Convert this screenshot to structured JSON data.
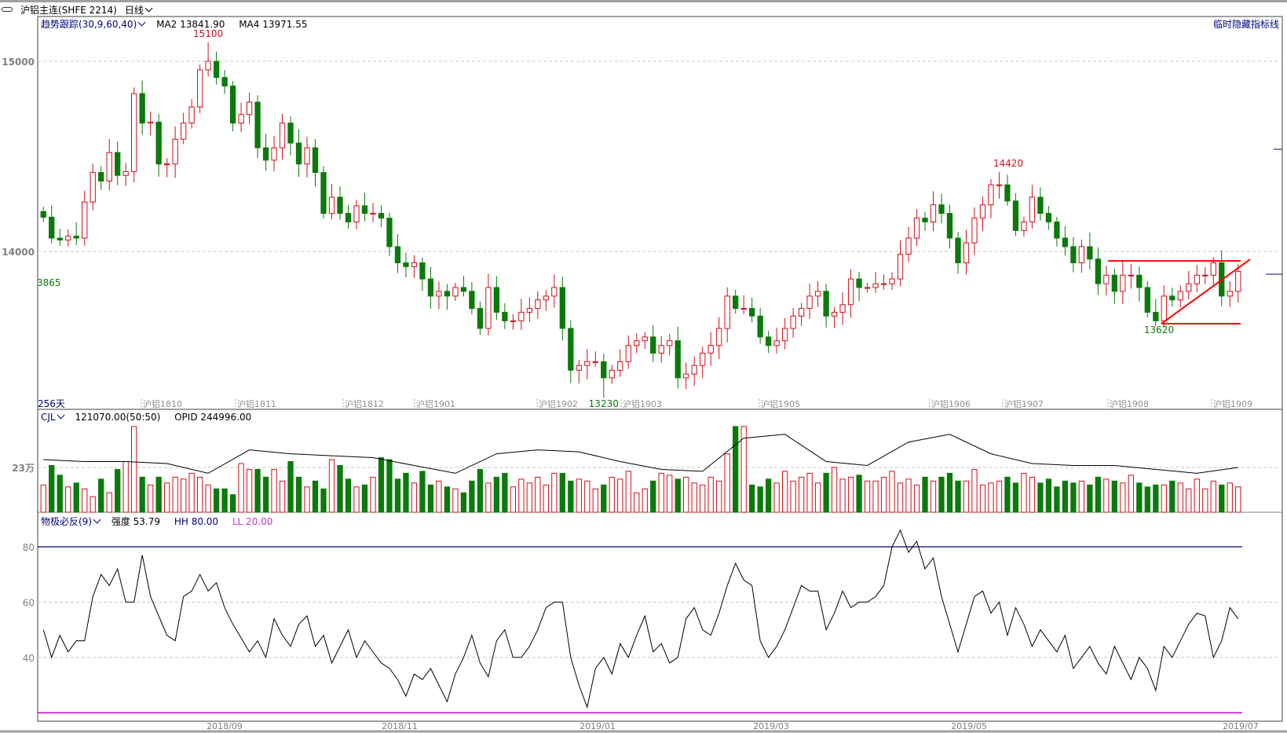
{
  "window": {
    "symbol_title": "沪铝主连(SHFE 2214)",
    "period": "日线",
    "hide_indicator_link": "临时隐藏指标线",
    "link_icon": "link-icon"
  },
  "price_panel": {
    "indicator": "趋势跟踪(30,9,60,40)",
    "ma2": "MA2 13841.90",
    "ma4": "MA4 13971.55",
    "day_count": "256天",
    "y_ticks": [
      "15000",
      "14000"
    ],
    "annotations": {
      "high": "15100",
      "low": "13230",
      "left_low": "3865",
      "peak": "14420",
      "recent_low": "13620"
    },
    "contract_labels": [
      "沪铝1810",
      "沪铝1811",
      "沪铝1812",
      "沪铝1901",
      "沪铝1902",
      "沪铝1903",
      "沪铝1905",
      "沪铝1906",
      "沪铝1907",
      "沪铝1908",
      "沪铝1909"
    ]
  },
  "volume_panel": {
    "name": "CJL",
    "value": "121070.00(50:50)",
    "opid": "OPID 244996.00",
    "y_tick": "23万"
  },
  "osc_panel": {
    "name": "物极必反(9)",
    "strength": "强度 53.79",
    "hh": "HH 80.00",
    "ll": "LL 20.00",
    "y_ticks": [
      "80",
      "60",
      "40"
    ]
  },
  "x_axis": {
    "dates": [
      "2018/09",
      "2018/11",
      "2019/01",
      "2019/03",
      "2019/05",
      "2019/07"
    ]
  },
  "colors": {
    "up": "#d0101a",
    "down": "#0a7a0a",
    "navy": "#000080",
    "ll": "#cc33cc",
    "trendline": "#ff0000"
  },
  "chart_data": [
    {
      "type": "candlestick",
      "title": "沪铝主连(SHFE 2214) 日线",
      "ylim": [
        13200,
        15150
      ],
      "yticks": [
        14000,
        15000
      ],
      "grid": true,
      "closes": [
        14180,
        14070,
        14060,
        14080,
        14070,
        14260,
        14415,
        14370,
        14520,
        14400,
        14420,
        14830,
        14675,
        14680,
        14460,
        14460,
        14590,
        14675,
        14760,
        14955,
        15000,
        14915,
        14870,
        14675,
        14720,
        14785,
        14545,
        14480,
        14545,
        14675,
        14570,
        14460,
        14545,
        14415,
        14200,
        14285,
        14200,
        14155,
        14240,
        14200,
        14200,
        14175,
        14025,
        13940,
        13920,
        13940,
        13855,
        13765,
        13790,
        13765,
        13810,
        13790,
        13700,
        13595,
        13810,
        13680,
        13635,
        13635,
        13680,
        13700,
        13745,
        13765,
        13810,
        13595,
        13375,
        13400,
        13420,
        13420,
        13335,
        13375,
        13420,
        13505,
        13530,
        13550,
        13465,
        13505,
        13530,
        13335,
        13355,
        13400,
        13465,
        13505,
        13595,
        13765,
        13700,
        13700,
        13660,
        13550,
        13505,
        13530,
        13595,
        13660,
        13700,
        13765,
        13790,
        13660,
        13680,
        13720,
        13855,
        13810,
        13810,
        13830,
        13830,
        13855,
        13985,
        14070,
        14175,
        14155,
        14245,
        14200,
        14070,
        13940,
        14045,
        14175,
        14245,
        14350,
        14350,
        14265,
        14110,
        14155,
        14285,
        14200,
        14155,
        14070,
        14025,
        13940,
        14025,
        13960,
        13830,
        13875,
        13790,
        13875,
        13875,
        13810,
        13680,
        13635,
        13765,
        13745,
        13790,
        13830,
        13875,
        13875,
        13940,
        13765,
        13790,
        13895
      ],
      "marked_high": 15100,
      "marked_low": 13230,
      "trendlines": {
        "resistance": 13950,
        "support": 13620
      }
    },
    {
      "type": "bar",
      "name": "CJL",
      "unit": "万",
      "reference": 23,
      "volumes": [
        14,
        24,
        19,
        13,
        15,
        12,
        8,
        17,
        10,
        22,
        26,
        44,
        18,
        14,
        18,
        15,
        18,
        17,
        20,
        18,
        14,
        12,
        12,
        9,
        25,
        22,
        22,
        18,
        22,
        16,
        26,
        18,
        13,
        16,
        12,
        27,
        24,
        17,
        13,
        14,
        18,
        28,
        27,
        17,
        20,
        15,
        21,
        14,
        16,
        13,
        12,
        10,
        16,
        22,
        15,
        18,
        20,
        13,
        17,
        15,
        18,
        14,
        20,
        20,
        16,
        17,
        16,
        12,
        14,
        18,
        17,
        21,
        10,
        12,
        16,
        20,
        19,
        17,
        18,
        15,
        14,
        18,
        16,
        30,
        44,
        44,
        14,
        13,
        17,
        15,
        21,
        16,
        18,
        20,
        15,
        20,
        23,
        17,
        18,
        19,
        16,
        16,
        18,
        21,
        15,
        17,
        14,
        18,
        16,
        18,
        20,
        16,
        16,
        22,
        14,
        15,
        16,
        18,
        15,
        20,
        18,
        15,
        17,
        13,
        16,
        15,
        16,
        14,
        18,
        17,
        16,
        15,
        19,
        15,
        13,
        14,
        14,
        16,
        15,
        12,
        17,
        12,
        16,
        14,
        15,
        13
      ],
      "open_interest_line": [
        27,
        26,
        26,
        25,
        20,
        32,
        30,
        29,
        28,
        24,
        20,
        30,
        32,
        31,
        26,
        22,
        21,
        38,
        40,
        26,
        24,
        36,
        40,
        30,
        25,
        24,
        24,
        22,
        20,
        23
      ]
    },
    {
      "type": "line",
      "name": "物极必反(9)",
      "hlines": {
        "HH": 80,
        "LL": 20
      },
      "yticks": [
        40,
        60,
        80
      ],
      "values": [
        50,
        40,
        48,
        42,
        46,
        46,
        62,
        70,
        66,
        72,
        60,
        60,
        77,
        62,
        55,
        48,
        46,
        62,
        64,
        70,
        64,
        67,
        58,
        52,
        47,
        42,
        46,
        40,
        54,
        48,
        44,
        52,
        55,
        44,
        48,
        38,
        44,
        50,
        40,
        46,
        42,
        38,
        36,
        32,
        26,
        34,
        32,
        36,
        30,
        24,
        34,
        40,
        48,
        38,
        33,
        46,
        50,
        40,
        40,
        44,
        50,
        58,
        60,
        60,
        40,
        30,
        22,
        36,
        40,
        34,
        45,
        40,
        48,
        55,
        42,
        45,
        38,
        40,
        54,
        58,
        50,
        48,
        56,
        66,
        74,
        68,
        66,
        46,
        40,
        44,
        50,
        58,
        66,
        64,
        64,
        50,
        56,
        64,
        58,
        60,
        60,
        62,
        66,
        80,
        86,
        78,
        82,
        72,
        76,
        62,
        52,
        42,
        52,
        62,
        64,
        56,
        60,
        48,
        58,
        52,
        44,
        50,
        46,
        42,
        48,
        36,
        40,
        44,
        38,
        34,
        44,
        38,
        32,
        40,
        36,
        28,
        44,
        40,
        46,
        52,
        56,
        55,
        40,
        46,
        58,
        54
      ]
    }
  ]
}
